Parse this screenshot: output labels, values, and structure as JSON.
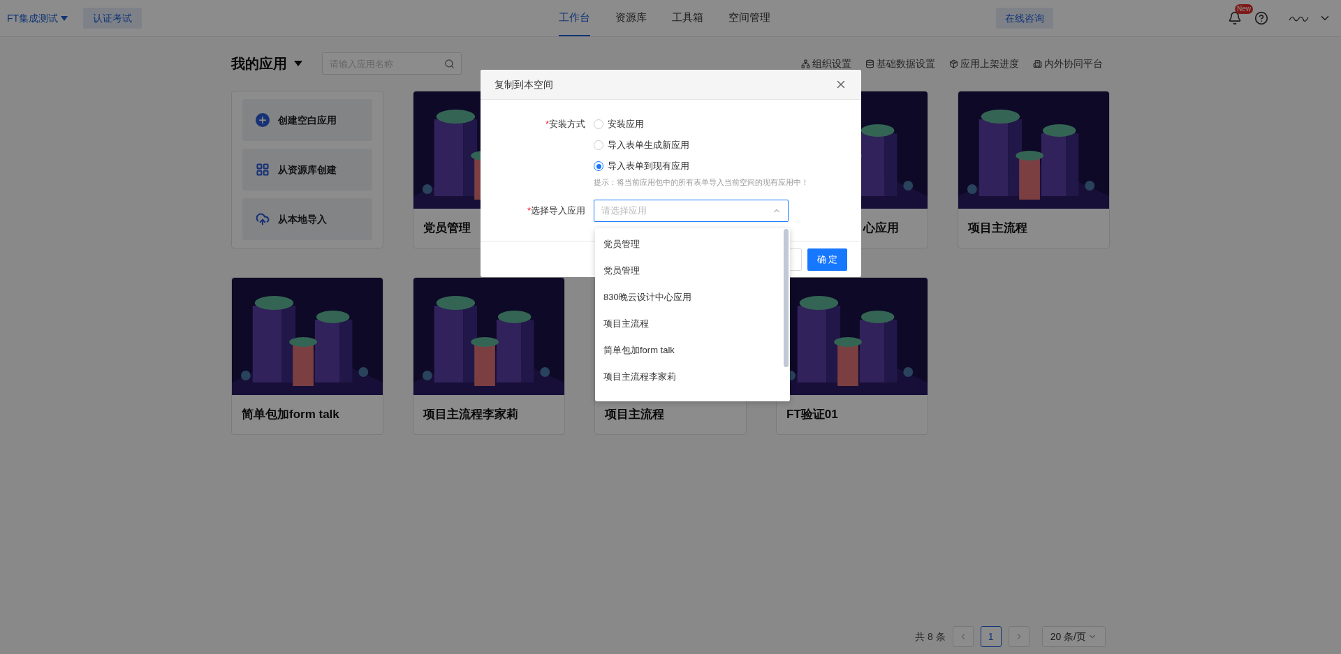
{
  "header": {
    "brand": "FT集成测试",
    "cert_button": "认证考试",
    "nav": [
      {
        "label": "工作台",
        "selected": true
      },
      {
        "label": "资源库",
        "selected": false
      },
      {
        "label": "工具箱",
        "selected": false
      },
      {
        "label": "空间管理",
        "selected": false
      }
    ],
    "consult_button": "在线咨询",
    "badge": "New"
  },
  "toolbar": {
    "title": "我的应用",
    "search_placeholder": "请输入应用名称",
    "links": [
      {
        "label": "组织设置",
        "kind": "org"
      },
      {
        "label": "基础数据设置",
        "kind": "data"
      },
      {
        "label": "应用上架进度",
        "kind": "progress"
      },
      {
        "label": "内外协同平台",
        "kind": "platform"
      }
    ]
  },
  "actions": [
    {
      "label": "创建空白应用",
      "kind": "blank"
    },
    {
      "label": "从资源库创建",
      "kind": "library"
    },
    {
      "label": "从本地导入",
      "kind": "local"
    }
  ],
  "cards": [
    {
      "title": "党员管理",
      "kind": "full"
    },
    {
      "title": "心应用",
      "kind": "partial"
    },
    {
      "title": "项目主流程",
      "kind": "full"
    },
    {
      "title": "简单包加form talk",
      "kind": "full"
    },
    {
      "title": "项目主流程李家莉",
      "kind": "full"
    },
    {
      "title": "项目主流程",
      "kind": "full"
    },
    {
      "title": "FT验证01",
      "kind": "full"
    }
  ],
  "pagination": {
    "total": "共 8 条",
    "pages": [
      {
        "label": "1",
        "selected": true
      }
    ],
    "page_size": "20 条/页"
  },
  "dialog": {
    "title": "复制到本空间",
    "required_mark": "*",
    "install_label": "安装方式",
    "options": [
      {
        "label": "安装应用",
        "selected": false
      },
      {
        "label": "导入表单生成新应用",
        "selected": false
      },
      {
        "label": "导入表单到现有应用",
        "selected": true
      }
    ],
    "hint": "提示：将当前应用包中的所有表单导入当前空间的现有应用中！",
    "select_label": "选择导入应用",
    "select_placeholder": "请选择应用",
    "dropdown": [
      "党员管理",
      "党员管理",
      "830晚云设计中心应用",
      "项目主流程",
      "简单包加form talk",
      "项目主流程李家莉"
    ],
    "confirm_button": "确 定"
  }
}
